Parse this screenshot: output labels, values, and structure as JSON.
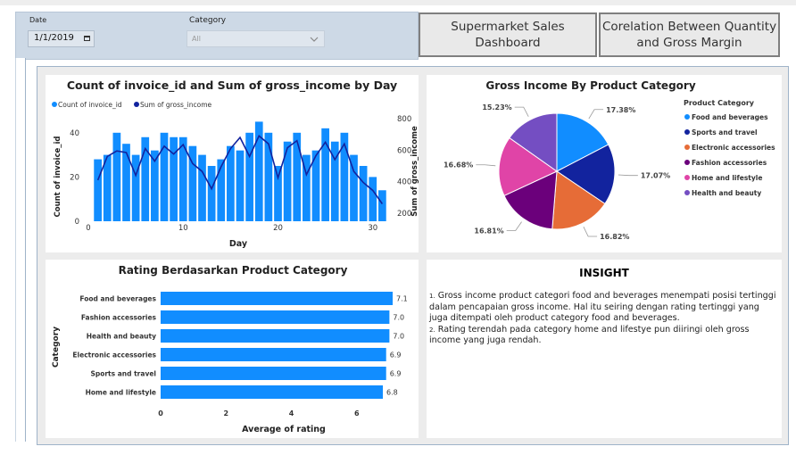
{
  "filters": {
    "date_label": "Date",
    "date_value": "1/1/2019",
    "category_label": "Category",
    "category_value": "All"
  },
  "header_buttons": {
    "dashboard": [
      "Supermarket Sales",
      "Dashboard"
    ],
    "correlation": [
      "Corelation Between Quantity",
      "and Gross Margin"
    ]
  },
  "colors": {
    "bar_blue": "#118dff",
    "line_navy": "#12239e",
    "filter_bg": "#cdd9e6"
  },
  "combo_chart": {
    "title": "Count of invoice_id and Sum of gross_income by Day",
    "legend": [
      "Count of invoice_id",
      "Sum of gross_income"
    ],
    "xlabel": "Day",
    "ylabel_left": "Count of invoice_id",
    "ylabel_right": "Sum of gross_income",
    "x_ticks": [
      "0",
      "10",
      "20",
      "30"
    ],
    "y_left_ticks": [
      "0",
      "20",
      "40"
    ],
    "y_right_ticks": [
      "200",
      "400",
      "600",
      "800"
    ]
  },
  "pie_chart": {
    "title": "Gross Income By Product Category",
    "legend_title": "Product Category"
  },
  "rating_chart": {
    "title": "Rating Berdasarkan Product Category",
    "xlabel": "Average of rating",
    "ylabel": "Category",
    "x_ticks": [
      "0",
      "2",
      "4",
      "6",
      "8"
    ]
  },
  "insight": {
    "title": "INSIGHT",
    "points": [
      {
        "num": "1.",
        "text": "Gross income product categori food and beverages menempati posisi tertinggi dalam pencapaian gross income. Hal itu seiring dengan rating tertinggi yang juga ditempati oleh product category food and beverages."
      },
      {
        "num": "2.",
        "text": "Rating terendah pada category home and lifestye pun diiringi oleh gross income yang juga rendah."
      }
    ]
  },
  "chart_data": [
    {
      "type": "bar",
      "title": "Count of invoice_id and Sum of gross_income by Day",
      "xlabel": "Day",
      "ylabel": "Count of invoice_id",
      "xlim": [
        0,
        32
      ],
      "ylim": [
        0,
        50
      ],
      "x": [
        1,
        2,
        3,
        4,
        5,
        6,
        7,
        8,
        9,
        10,
        11,
        12,
        13,
        14,
        15,
        16,
        17,
        18,
        19,
        20,
        21,
        22,
        23,
        24,
        25,
        26,
        27,
        28,
        29,
        30,
        31
      ],
      "series": [
        {
          "name": "Count of invoice_id",
          "axis": "left",
          "kind": "bar",
          "values": [
            28,
            30,
            40,
            35,
            30,
            38,
            32,
            40,
            38,
            38,
            34,
            30,
            25,
            28,
            34,
            32,
            40,
            45,
            40,
            25,
            36,
            40,
            30,
            32,
            42,
            36,
            40,
            30,
            25,
            20,
            14
          ]
        },
        {
          "name": "Sum of gross_income",
          "axis": "right",
          "kind": "line",
          "ylim": [
            150,
            850
          ],
          "values": [
            410,
            560,
            595,
            585,
            440,
            610,
            530,
            625,
            575,
            635,
            515,
            465,
            355,
            495,
            610,
            680,
            560,
            690,
            640,
            425,
            615,
            660,
            445,
            565,
            650,
            540,
            640,
            465,
            395,
            345,
            260
          ]
        }
      ]
    },
    {
      "type": "pie",
      "title": "Gross Income By Product Category",
      "legend_title": "Product Category",
      "categories": [
        "Food and beverages",
        "Sports and travel",
        "Electronic accessories",
        "Fashion accessories",
        "Home and lifestyle",
        "Health and beauty"
      ],
      "values": [
        17.38,
        17.07,
        16.82,
        16.81,
        16.68,
        15.23
      ],
      "labels": [
        "17.38%",
        "17.07%",
        "16.82%",
        "16.81%",
        "16.68%",
        "15.23%"
      ],
      "colors": [
        "#118dff",
        "#12239e",
        "#e66c37",
        "#6b007b",
        "#e044a7",
        "#744ec2"
      ],
      "legend": "right"
    },
    {
      "type": "bar",
      "orientation": "horizontal",
      "title": "Rating Berdasarkan Product Category",
      "xlabel": "Average of rating",
      "ylabel": "Category",
      "xlim": [
        0,
        8
      ],
      "categories": [
        "Food and beverages",
        "Fashion accessories",
        "Health and beauty",
        "Electronic accessories",
        "Sports and travel",
        "Home and lifestyle"
      ],
      "values": [
        7.1,
        7.0,
        7.0,
        6.9,
        6.9,
        6.8
      ],
      "labels": [
        "7.1",
        "7.0",
        "7.0",
        "6.9",
        "6.9",
        "6.8"
      ]
    }
  ]
}
